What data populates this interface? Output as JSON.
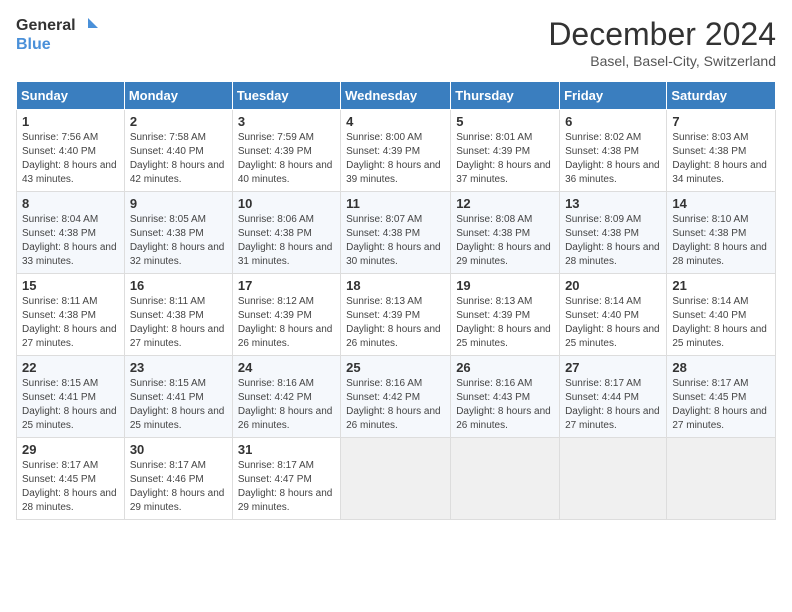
{
  "logo": {
    "text_general": "General",
    "text_blue": "Blue"
  },
  "title": "December 2024",
  "subtitle": "Basel, Basel-City, Switzerland",
  "days_of_week": [
    "Sunday",
    "Monday",
    "Tuesday",
    "Wednesday",
    "Thursday",
    "Friday",
    "Saturday"
  ],
  "weeks": [
    [
      {
        "day": "1",
        "sunrise": "7:56 AM",
        "sunset": "4:40 PM",
        "daylight": "8 hours and 43 minutes."
      },
      {
        "day": "2",
        "sunrise": "7:58 AM",
        "sunset": "4:40 PM",
        "daylight": "8 hours and 42 minutes."
      },
      {
        "day": "3",
        "sunrise": "7:59 AM",
        "sunset": "4:39 PM",
        "daylight": "8 hours and 40 minutes."
      },
      {
        "day": "4",
        "sunrise": "8:00 AM",
        "sunset": "4:39 PM",
        "daylight": "8 hours and 39 minutes."
      },
      {
        "day": "5",
        "sunrise": "8:01 AM",
        "sunset": "4:39 PM",
        "daylight": "8 hours and 37 minutes."
      },
      {
        "day": "6",
        "sunrise": "8:02 AM",
        "sunset": "4:38 PM",
        "daylight": "8 hours and 36 minutes."
      },
      {
        "day": "7",
        "sunrise": "8:03 AM",
        "sunset": "4:38 PM",
        "daylight": "8 hours and 34 minutes."
      }
    ],
    [
      {
        "day": "8",
        "sunrise": "8:04 AM",
        "sunset": "4:38 PM",
        "daylight": "8 hours and 33 minutes."
      },
      {
        "day": "9",
        "sunrise": "8:05 AM",
        "sunset": "4:38 PM",
        "daylight": "8 hours and 32 minutes."
      },
      {
        "day": "10",
        "sunrise": "8:06 AM",
        "sunset": "4:38 PM",
        "daylight": "8 hours and 31 minutes."
      },
      {
        "day": "11",
        "sunrise": "8:07 AM",
        "sunset": "4:38 PM",
        "daylight": "8 hours and 30 minutes."
      },
      {
        "day": "12",
        "sunrise": "8:08 AM",
        "sunset": "4:38 PM",
        "daylight": "8 hours and 29 minutes."
      },
      {
        "day": "13",
        "sunrise": "8:09 AM",
        "sunset": "4:38 PM",
        "daylight": "8 hours and 28 minutes."
      },
      {
        "day": "14",
        "sunrise": "8:10 AM",
        "sunset": "4:38 PM",
        "daylight": "8 hours and 28 minutes."
      }
    ],
    [
      {
        "day": "15",
        "sunrise": "8:11 AM",
        "sunset": "4:38 PM",
        "daylight": "8 hours and 27 minutes."
      },
      {
        "day": "16",
        "sunrise": "8:11 AM",
        "sunset": "4:38 PM",
        "daylight": "8 hours and 27 minutes."
      },
      {
        "day": "17",
        "sunrise": "8:12 AM",
        "sunset": "4:39 PM",
        "daylight": "8 hours and 26 minutes."
      },
      {
        "day": "18",
        "sunrise": "8:13 AM",
        "sunset": "4:39 PM",
        "daylight": "8 hours and 26 minutes."
      },
      {
        "day": "19",
        "sunrise": "8:13 AM",
        "sunset": "4:39 PM",
        "daylight": "8 hours and 25 minutes."
      },
      {
        "day": "20",
        "sunrise": "8:14 AM",
        "sunset": "4:40 PM",
        "daylight": "8 hours and 25 minutes."
      },
      {
        "day": "21",
        "sunrise": "8:14 AM",
        "sunset": "4:40 PM",
        "daylight": "8 hours and 25 minutes."
      }
    ],
    [
      {
        "day": "22",
        "sunrise": "8:15 AM",
        "sunset": "4:41 PM",
        "daylight": "8 hours and 25 minutes."
      },
      {
        "day": "23",
        "sunrise": "8:15 AM",
        "sunset": "4:41 PM",
        "daylight": "8 hours and 25 minutes."
      },
      {
        "day": "24",
        "sunrise": "8:16 AM",
        "sunset": "4:42 PM",
        "daylight": "8 hours and 26 minutes."
      },
      {
        "day": "25",
        "sunrise": "8:16 AM",
        "sunset": "4:42 PM",
        "daylight": "8 hours and 26 minutes."
      },
      {
        "day": "26",
        "sunrise": "8:16 AM",
        "sunset": "4:43 PM",
        "daylight": "8 hours and 26 minutes."
      },
      {
        "day": "27",
        "sunrise": "8:17 AM",
        "sunset": "4:44 PM",
        "daylight": "8 hours and 27 minutes."
      },
      {
        "day": "28",
        "sunrise": "8:17 AM",
        "sunset": "4:45 PM",
        "daylight": "8 hours and 27 minutes."
      }
    ],
    [
      {
        "day": "29",
        "sunrise": "8:17 AM",
        "sunset": "4:45 PM",
        "daylight": "8 hours and 28 minutes."
      },
      {
        "day": "30",
        "sunrise": "8:17 AM",
        "sunset": "4:46 PM",
        "daylight": "8 hours and 29 minutes."
      },
      {
        "day": "31",
        "sunrise": "8:17 AM",
        "sunset": "4:47 PM",
        "daylight": "8 hours and 29 minutes."
      },
      null,
      null,
      null,
      null
    ]
  ]
}
